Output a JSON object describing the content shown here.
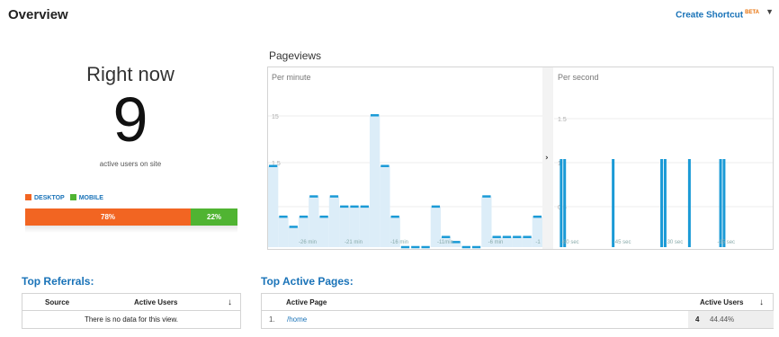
{
  "header": {
    "title": "Overview",
    "shortcut_label": "Create Shortcut",
    "beta_badge": "BETA",
    "dropdown_icon": "chevron-down-icon"
  },
  "realtime": {
    "heading": "Right now",
    "active_users": "9",
    "active_label": "active users on site",
    "legend": [
      {
        "label": "DESKTOP",
        "color": "#f26522"
      },
      {
        "label": "MOBILE",
        "color": "#50b432"
      }
    ],
    "device_split": [
      {
        "label": "78%",
        "percent": 78,
        "color": "#f26522"
      },
      {
        "label": "22%",
        "percent": 22,
        "color": "#50b432"
      }
    ]
  },
  "pageviews": {
    "title": "Pageviews",
    "per_minute_label": "Per minute",
    "per_second_label": "Per second",
    "expand_icon": "chevron-right-icon",
    "colors": {
      "bar": "#dcedf8",
      "line": "#1a9ad6"
    },
    "per_minute": {
      "y_ticks": [
        "15",
        "1.5",
        "1"
      ],
      "x_ticks": [
        "-26 min",
        "-21 min",
        "-16 min",
        "-11min",
        "-6 min",
        "-1"
      ],
      "values": [
        8,
        3,
        2,
        3,
        5,
        3,
        5,
        4,
        4,
        4,
        13,
        8,
        3,
        0,
        0,
        0,
        4,
        1,
        0.5,
        0,
        0,
        5,
        1,
        1,
        1,
        1,
        3
      ]
    },
    "per_second": {
      "y_ticks": [
        "1.5",
        "1",
        "0.5"
      ],
      "x_ticks": [
        "-60 sec",
        "-45 sec",
        "-30 sec",
        "-15 sec"
      ],
      "spikes": [
        -60,
        -59,
        -45,
        -31,
        -30,
        -23,
        -14,
        -13
      ]
    }
  },
  "top_referrals": {
    "title": "Top Referrals:",
    "columns": [
      "Source",
      "Active Users"
    ],
    "sort_icon": "arrow-down-icon",
    "empty_message": "There is no data for this view."
  },
  "top_pages": {
    "title": "Top Active Pages:",
    "columns": [
      "Active Page",
      "Active Users"
    ],
    "sort_icon": "arrow-down-icon",
    "rows": [
      {
        "index": "1.",
        "page": "/home",
        "users": "4",
        "percent": "44.44%"
      }
    ]
  }
}
